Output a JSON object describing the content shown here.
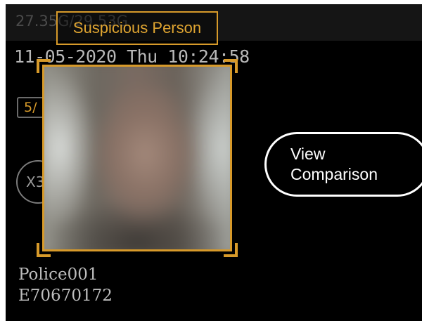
{
  "status": {
    "storage": "27.35G/29.53G"
  },
  "datetime": "11-05-2020 Thu 10:24:58",
  "counter_badge": "5/",
  "zoom_button": "X3",
  "alert": {
    "label": "Suspicious Person",
    "accent_color": "#d79a2a"
  },
  "face_capture": {
    "icon": "blurred-face-photo"
  },
  "comparison_button": {
    "line1": "View",
    "line2": "Comparison"
  },
  "officer": {
    "name": "Police001",
    "device_id": "E70670172"
  }
}
